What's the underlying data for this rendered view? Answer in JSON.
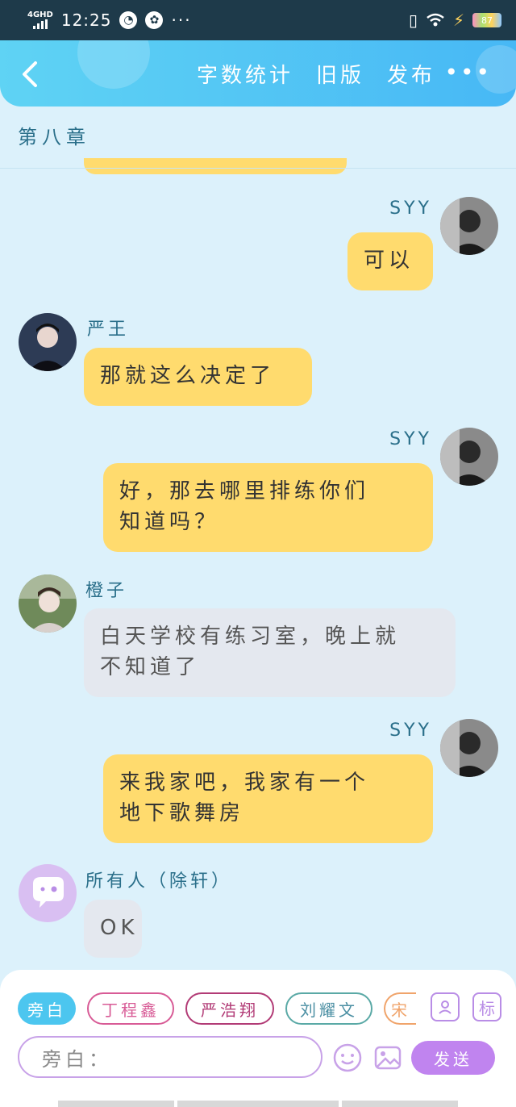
{
  "status_bar": {
    "network": "4GHD",
    "time": "12:25",
    "more": "···",
    "battery": "87"
  },
  "header": {
    "actions": [
      "字数统计",
      "旧版",
      "发布"
    ],
    "more": "•••"
  },
  "chapter": "第八章",
  "messages": [
    {
      "speaker": "SYY",
      "side": "right",
      "text": "可以",
      "style": "yellow"
    },
    {
      "speaker": "严王",
      "side": "left",
      "text": "那就这么决定了",
      "style": "yellow"
    },
    {
      "speaker": "SYY",
      "side": "right",
      "line1": "好，那去哪里排练你们",
      "line2": "知道吗？",
      "style": "yellow"
    },
    {
      "speaker": "橙子",
      "side": "left",
      "line1": "白天学校有练习室，晚上就",
      "line2": "不知道了",
      "style": "gray"
    },
    {
      "speaker": "SYY",
      "side": "right",
      "line1": "来我家吧，我家有一个",
      "line2": "地下歌舞房",
      "style": "yellow"
    },
    {
      "speaker": "所有人（除轩）",
      "side": "left",
      "text": "OK",
      "style": "gray"
    }
  ],
  "composer": {
    "chips": [
      "旁白",
      "丁程鑫",
      "严浩翔",
      "刘耀文",
      "宋"
    ],
    "tag_button": "标",
    "input_placeholder": "旁白：",
    "send_label": "发送"
  },
  "colors": {
    "background": "#dcf1fb",
    "header_gradient_start": "#5fd3f4",
    "header_gradient_end": "#47b8f5",
    "bubble_yellow": "#ffdb6e",
    "bubble_gray": "#e4e8ef",
    "send_button": "#c084ef"
  }
}
